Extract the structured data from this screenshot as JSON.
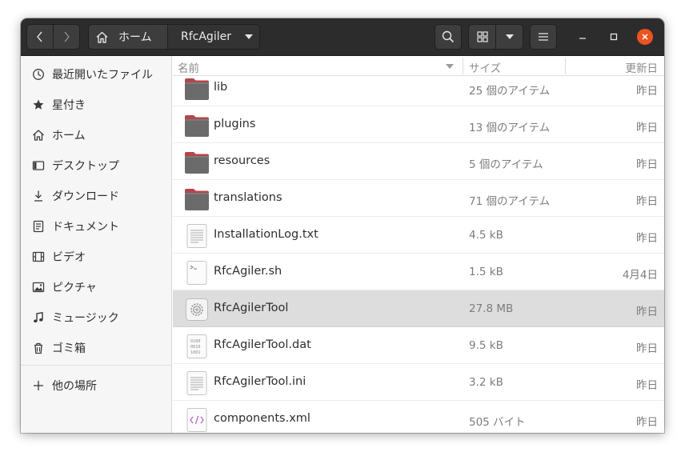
{
  "header": {
    "breadcrumb_home": "ホーム",
    "breadcrumb_current": "RfcAgiler"
  },
  "sidebar": {
    "items": [
      {
        "label": "最近開いたファイル",
        "icon": "clock-icon"
      },
      {
        "label": "星付き",
        "icon": "star-icon"
      },
      {
        "label": "ホーム",
        "icon": "home-icon"
      },
      {
        "label": "デスクトップ",
        "icon": "desktop-icon"
      },
      {
        "label": "ダウンロード",
        "icon": "download-icon"
      },
      {
        "label": "ドキュメント",
        "icon": "document-icon"
      },
      {
        "label": "ビデオ",
        "icon": "video-icon"
      },
      {
        "label": "ピクチャ",
        "icon": "picture-icon"
      },
      {
        "label": "ミュージック",
        "icon": "music-icon"
      },
      {
        "label": "ゴミ箱",
        "icon": "trash-icon"
      }
    ],
    "other_locations": "他の場所"
  },
  "columns": {
    "name": "名前",
    "size": "サイズ",
    "modified": "更新日"
  },
  "files": [
    {
      "name": "lib",
      "size": "25 個のアイテム",
      "modified": "昨日",
      "type": "folder"
    },
    {
      "name": "plugins",
      "size": "13 個のアイテム",
      "modified": "昨日",
      "type": "folder"
    },
    {
      "name": "resources",
      "size": "5 個のアイテム",
      "modified": "昨日",
      "type": "folder"
    },
    {
      "name": "translations",
      "size": "71 個のアイテム",
      "modified": "昨日",
      "type": "folder"
    },
    {
      "name": "InstallationLog.txt",
      "size": "4.5 kB",
      "modified": "昨日",
      "type": "text"
    },
    {
      "name": "RfcAgiler.sh",
      "size": "1.5 kB",
      "modified": "4月4日",
      "type": "script"
    },
    {
      "name": "RfcAgilerTool",
      "size": "27.8 MB",
      "modified": "昨日",
      "type": "executable",
      "selected": true
    },
    {
      "name": "RfcAgilerTool.dat",
      "size": "9.5 kB",
      "modified": "昨日",
      "type": "binary"
    },
    {
      "name": "RfcAgilerTool.ini",
      "size": "3.2 kB",
      "modified": "昨日",
      "type": "text"
    },
    {
      "name": "components.xml",
      "size": "505 バイト",
      "modified": "昨日",
      "type": "xml"
    }
  ],
  "colors": {
    "header_bg": "#2c2c2c",
    "close_button": "#e95420",
    "folder_body": "#6b6b6b",
    "folder_tab": "#b7444a",
    "selected_row": "#dddddd"
  }
}
